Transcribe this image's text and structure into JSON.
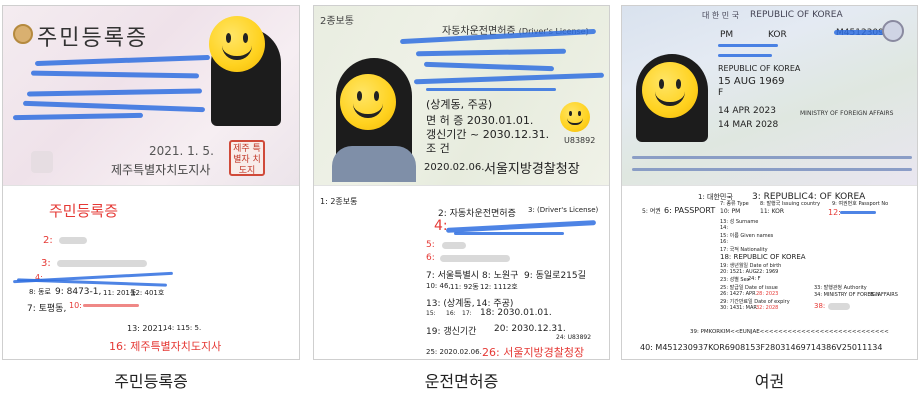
{
  "captions": {
    "id_card": "주민등록증",
    "license": "운전면허증",
    "passport": "여권"
  },
  "id_card": {
    "photo": {
      "title": "주민등록증",
      "date": "2021. 1. 5.",
      "issuer": "제주특별자치도지사",
      "stamp": "제주 특별자 치도지"
    },
    "labels": {
      "f1": "주민등록증",
      "f3": "3:",
      "f2": "2:",
      "f4": "4:",
      "f8": "8: 동로",
      "f9": "9: 8473-1,",
      "f11": "11: 201동",
      "f12": "12: 401호",
      "f7": "7: 토평동,",
      "f10": "10:",
      "f13": "13: 2021.",
      "f14": "14: 1.",
      "f15": "15: 5.",
      "f16": "16: 제주특별자치도지사"
    }
  },
  "license": {
    "photo": {
      "type": "2종보통",
      "title": "자동차운전면허증",
      "title_en": "(Driver's License)",
      "addr": "(상계동, 주공)",
      "expiry": "면 허 증  2030.01.01.",
      "renew": "갱신기간  ~ 2030.12.31.",
      "cond": "조 건",
      "code": "U83892",
      "issued": "2020.02.06.",
      "issuer": "서울지방경찰청장"
    },
    "labels": {
      "f1": "1: 2종보통",
      "f2": "2: 자동차운전면허증",
      "f3": "3: (Driver's License)",
      "f4": "4:",
      "f5": "5:",
      "f6": "6:",
      "f7": "7: 서울특별시",
      "f8": "8: 노원구",
      "f9": "9: 동일로215길",
      "f10": "10: 46,",
      "f11": "11: 92동",
      "f12": "12: 1112호",
      "f13": "13: (상계동,",
      "f14": "14: 주공)",
      "f15": "15:",
      "f16": "16:",
      "f17": "17:",
      "f18": "18: 2030.01.01.",
      "f19": "19: 갱신기간",
      "f20": "20: 2030.12.31.",
      "f24": "24: U83892",
      "f25": "25: 2020.02.06.",
      "f26": "26: 서울지방경찰청장"
    }
  },
  "passport": {
    "photo": {
      "country_ko": "대 한 민 국",
      "country_en": "REPUBLIC OF KOREA",
      "type": "PM",
      "code": "KOR",
      "number": "M45123093",
      "nationality": "REPUBLIC OF KOREA",
      "birth": "15 AUG 1969",
      "sex": "F",
      "issue": "14 APR 2023",
      "expiry": "14 MAR 2028",
      "authority": "MINISTRY OF FOREIGN AFFAIRS"
    },
    "labels": {
      "f1": "1: 대한민국",
      "f3": "3: REPUBLIC",
      "f4": "4: OF KOREA",
      "f5": "5: 여권",
      "f6": "6: PASSPORT",
      "f7": "7: 종류 Type",
      "f8": "8: 발행국 Issuing country",
      "f9": "9: 여권번호 Passport No",
      "f10": "10: PM",
      "f11": "11: KOR",
      "f12": "12:",
      "f13": "13: 성 Surname",
      "f14": "14:",
      "f15": "15: 이름 Given names",
      "f16": "16:",
      "f17": "17: 국적 Nationality",
      "f18": "18: REPUBLIC OF KOREA",
      "f19": "19: 생년월일 Date of birth",
      "f20": "20: 15",
      "f21": "21: AUG",
      "f22": "22: 1969",
      "f23": "23: 성별 Sex",
      "f24": "24: F",
      "f25": "25: 발급일 Date of issue",
      "f26": "26: 14",
      "f27": "27: APR",
      "f28": "28: 2023",
      "f29": "29: 기간만료일 Date of expiry",
      "f30": "30: 14",
      "f31": "31: MAR",
      "f32": "32: 2028",
      "f33": "33: 발행관청 Authority",
      "f34": "34: MINISTRY OF FOREIGN",
      "f35": "35: AFFAIRS",
      "f38": "38:",
      "f39": "39: PMKORKIM<<EUNJAE<<<<<<<<<<<<<<<<<<<<<<<<<<<<",
      "f40": "40: M451230937KOR6908153F28031469714386V25011134"
    }
  }
}
